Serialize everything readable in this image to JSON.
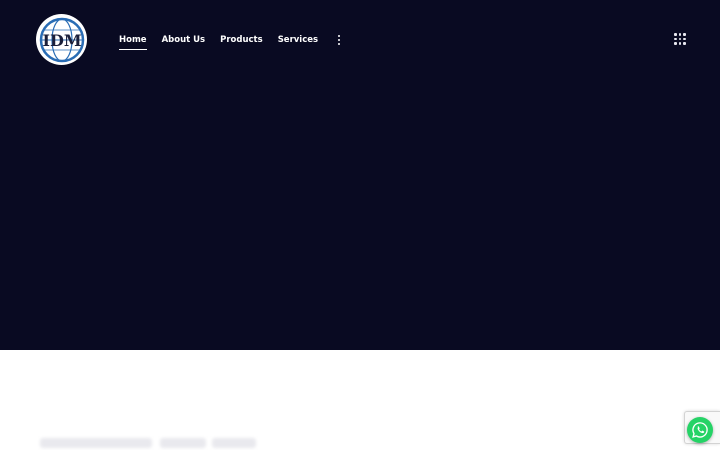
{
  "header": {
    "logo_text": "IDM",
    "logo_colors": {
      "ring": "#2a6db5",
      "text": "#1b1f3a"
    },
    "nav": {
      "items": [
        {
          "label": "Home",
          "active": true
        },
        {
          "label": "About Us",
          "active": false
        },
        {
          "label": "Products",
          "active": false
        },
        {
          "label": "Services",
          "active": false
        }
      ],
      "more_icon": "vertical-dots-icon"
    },
    "menu_icon": "grid-dots-icon"
  },
  "theme": {
    "hero_background": "#090a22",
    "page_background": "#ffffff",
    "nav_text": "#ffffff",
    "whatsapp_green": "#25d366"
  },
  "floating": {
    "whatsapp_icon": "whatsapp-icon",
    "recaptcha_icon": "recaptcha-badge"
  }
}
